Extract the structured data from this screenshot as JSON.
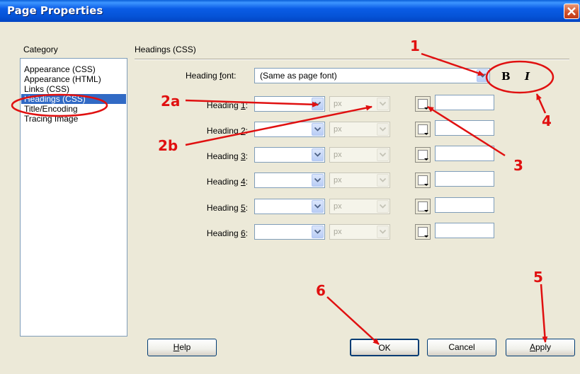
{
  "window": {
    "title": "Page Properties"
  },
  "category": {
    "label": "Category",
    "items": [
      {
        "label": "Appearance (CSS)"
      },
      {
        "label": "Appearance (HTML)"
      },
      {
        "label": "Links (CSS)"
      },
      {
        "label": "Headings (CSS)",
        "selected": true
      },
      {
        "label": "Title/Encoding"
      },
      {
        "label": "Tracing Image"
      }
    ]
  },
  "section": {
    "title": "Headings (CSS)"
  },
  "heading_font": {
    "label_pre": "Heading ",
    "label_key": "f",
    "label_post": "ont:",
    "value": "(Same as page font)",
    "bold_label": "B",
    "italic_label": "I"
  },
  "headings": [
    {
      "pre": "Heading ",
      "key": "1",
      "post": ":",
      "size": "",
      "unit": "px",
      "color": ""
    },
    {
      "pre": "Heading ",
      "key": "2",
      "post": ":",
      "size": "",
      "unit": "px",
      "color": ""
    },
    {
      "pre": "Heading ",
      "key": "3",
      "post": ":",
      "size": "",
      "unit": "px",
      "color": ""
    },
    {
      "pre": "Heading ",
      "key": "4",
      "post": ":",
      "size": "",
      "unit": "px",
      "color": ""
    },
    {
      "pre": "Heading ",
      "key": "5",
      "post": ":",
      "size": "",
      "unit": "px",
      "color": ""
    },
    {
      "pre": "Heading ",
      "key": "6",
      "post": ":",
      "size": "",
      "unit": "px",
      "color": ""
    }
  ],
  "buttons": {
    "help": {
      "key": "H",
      "rest": "elp"
    },
    "ok": "OK",
    "cancel": "Cancel",
    "apply": {
      "key": "A",
      "rest": "pply"
    }
  },
  "annotations": [
    "1",
    "2a",
    "2b",
    "3",
    "4",
    "5",
    "6"
  ],
  "colors": {
    "title_bar": "#0a5ce6",
    "selection": "#316ac5",
    "annotation": "#e01010"
  }
}
